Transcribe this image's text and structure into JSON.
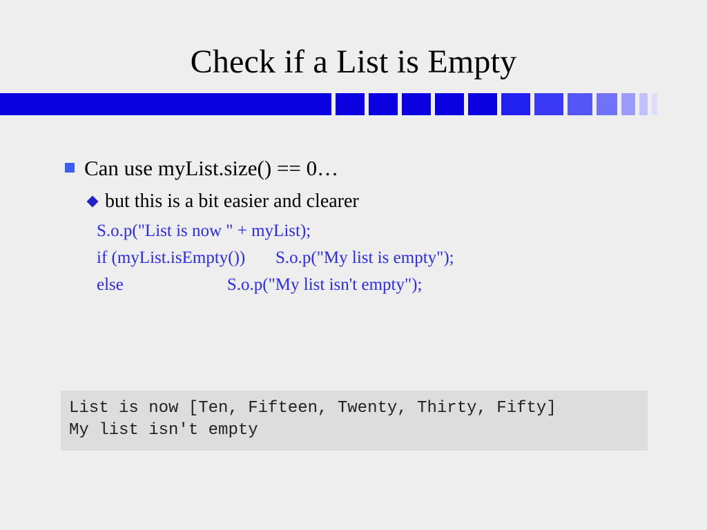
{
  "title": "Check if a List is Empty",
  "bullet": {
    "main": "Can use myList.size() == 0…",
    "sub": "but this is a bit easier and clearer"
  },
  "code": {
    "line1": "S.o.p(\"List is now \" + myList);",
    "line2": "if (myList.isEmpty())       S.o.p(\"My list is empty\");",
    "line3": "else                        S.o.p(\"My list isn't empty\");"
  },
  "output": {
    "line1": "List is now [Ten, Fifteen, Twenty, Thirty, Fifty]",
    "line2": "My list isn't empty"
  },
  "ribbon": {
    "colors": [
      "#0b00e0",
      "#0b00e0",
      "#0b00e0",
      "#0b00e0",
      "#0b00e0",
      "#0b00e0",
      "#2020f0",
      "#3a3af5",
      "#5656f7",
      "#7272f8",
      "#9a9af9",
      "#c0c0fb",
      "#dedefc"
    ],
    "widths": [
      480,
      42,
      42,
      42,
      42,
      42,
      42,
      42,
      36,
      30,
      20,
      12,
      8
    ]
  }
}
